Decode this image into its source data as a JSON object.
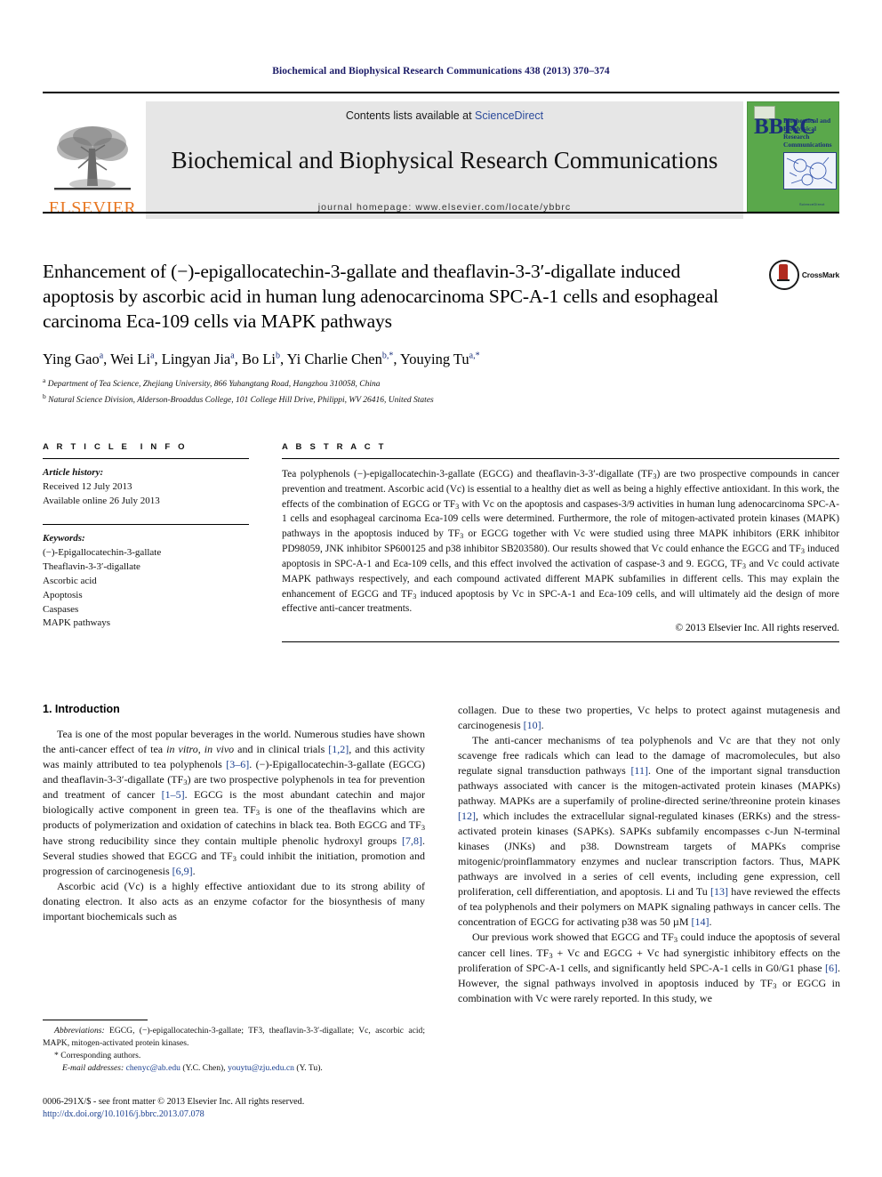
{
  "running_head": "Biochemical and Biophysical Research Communications 438 (2013) 370–374",
  "masthead": {
    "publisher": "ELSEVIER",
    "contents_prefix": "Contents lists available at ",
    "contents_link": "ScienceDirect",
    "journal_title": "Biochemical and Biophysical Research Communications",
    "homepage": "journal homepage: www.elsevier.com/locate/ybbrc",
    "cover": {
      "acronym": "BBRC",
      "title_lines": "Biochemical and Biophysical Research Communications",
      "footer": "ScienceDirect"
    }
  },
  "article": {
    "title": "Enhancement of (−)-epigallocatechin-3-gallate and theaflavin-3-3′-digallate induced apoptosis by ascorbic acid in human lung adenocarcinoma SPC-A-1 cells and esophageal carcinoma Eca-109 cells via MAPK pathways",
    "crossmark_label": "CrossMark",
    "authors": "Ying Gao a, Wei Li a, Lingyan Jia a, Bo Li b, Yi Charlie Chen b,*, Youying Tu a,*",
    "affiliations": [
      "a Department of Tea Science, Zhejiang University, 866 Yuhangtang Road, Hangzhou 310058, China",
      "b Natural Science Division, Alderson-Broaddus College, 101 College Hill Drive, Philippi, WV 26416, United States"
    ]
  },
  "article_info": {
    "heading": "ARTICLE INFO",
    "history_label": "Article history:",
    "history": [
      "Received 12 July 2013",
      "Available online 26 July 2013"
    ],
    "keywords_label": "Keywords:",
    "keywords": [
      "(−)-Epigallocatechin-3-gallate",
      "Theaflavin-3-3′-digallate",
      "Ascorbic acid",
      "Apoptosis",
      "Caspases",
      "MAPK pathways"
    ]
  },
  "abstract": {
    "heading": "ABSTRACT",
    "text": "Tea polyphenols (−)-epigallocatechin-3-gallate (EGCG) and theaflavin-3-3′-digallate (TF3) are two prospective compounds in cancer prevention and treatment. Ascorbic acid (Vc) is essential to a healthy diet as well as being a highly effective antioxidant. In this work, the effects of the combination of EGCG or TF3 with Vc on the apoptosis and caspases-3/9 activities in human lung adenocarcinoma SPC-A-1 cells and esophageal carcinoma Eca-109 cells were determined. Furthermore, the role of mitogen-activated protein kinases (MAPK) pathways in the apoptosis induced by TF3 or EGCG together with Vc were studied using three MAPK inhibitors (ERK inhibitor PD98059, JNK inhibitor SP600125 and p38 inhibitor SB203580). Our results showed that Vc could enhance the EGCG and TF3 induced apoptosis in SPC-A-1 and Eca-109 cells, and this effect involved the activation of caspase-3 and 9. EGCG, TF3 and Vc could activate MAPK pathways respectively, and each compound activated different MAPK subfamilies in different cells. This may explain the enhancement of EGCG and TF3 induced apoptosis by Vc in SPC-A-1 and Eca-109 cells, and will ultimately aid the design of more effective anti-cancer treatments.",
    "copyright": "© 2013 Elsevier Inc. All rights reserved."
  },
  "introduction": {
    "heading": "1. Introduction",
    "left_paragraphs": [
      "Tea is one of the most popular beverages in the world. Numerous studies have shown the anti-cancer effect of tea in vitro, in vivo and in clinical trials [1,2], and this activity was mainly attributed to tea polyphenols [3–6]. (−)-Epigallocatechin-3-gallate (EGCG) and theaflavin-3-3′-digallate (TF3) are two prospective polyphenols in tea for prevention and treatment of cancer [1–5]. EGCG is the most abundant catechin and major biologically active component in green tea. TF3 is one of the theaflavins which are products of polymerization and oxidation of catechins in black tea. Both EGCG and TF3 have strong reducibility since they contain multiple phenolic hydroxyl groups [7,8]. Several studies showed that EGCG and TF3 could inhibit the initiation, promotion and progression of carcinogenesis [6,9].",
      "Ascorbic acid (Vc) is a highly effective antioxidant due to its strong ability of donating electron. It also acts as an enzyme cofactor for the biosynthesis of many important biochemicals such as"
    ],
    "right_paragraphs": [
      "collagen. Due to these two properties, Vc helps to protect against mutagenesis and carcinogenesis [10].",
      "The anti-cancer mechanisms of tea polyphenols and Vc are that they not only scavenge free radicals which can lead to the damage of macromolecules, but also regulate signal transduction pathways [11]. One of the important signal transduction pathways associated with cancer is the mitogen-activated protein kinases (MAPKs) pathway. MAPKs are a superfamily of proline-directed serine/threonine protein kinases [12], which includes the extracellular signal-regulated kinases (ERKs) and the stress-activated protein kinases (SAPKs). SAPKs subfamily encompasses c-Jun N-terminal kinases (JNKs) and p38. Downstream targets of MAPKs comprise mitogenic/proinflammatory enzymes and nuclear transcription factors. Thus, MAPK pathways are involved in a series of cell events, including gene expression, cell proliferation, cell differentiation, and apoptosis. Li and Tu [13] have reviewed the effects of tea polyphenols and their polymers on MAPK signaling pathways in cancer cells. The concentration of EGCG for activating p38 was 50 µM [14].",
      "Our previous work showed that EGCG and TF3 could induce the apoptosis of several cancer cell lines. TF3 + Vc and EGCG + Vc had synergistic inhibitory effects on the proliferation of SPC-A-1 cells, and significantly held SPC-A-1 cells in G0/G1 phase [6]. However, the signal pathways involved in apoptosis induced by TF3 or EGCG in combination with Vc were rarely reported. In this study, we"
    ]
  },
  "footnotes": {
    "abbreviations_label": "Abbreviations:",
    "abbreviations_text": "EGCG, (−)-epigallocatechin-3-gallate; TF3, theaflavin-3-3′-digallate; Vc, ascorbic acid; MAPK, mitogen-activated protein kinases.",
    "corresponding": "* Corresponding authors.",
    "email_label": "E-mail addresses:",
    "email_1": "chenyc@ab.edu",
    "email_1_owner": "(Y.C. Chen),",
    "email_2": "youytu@zju.edu.cn",
    "email_2_owner": "(Y. Tu)."
  },
  "imprint": {
    "issn_line": "0006-291X/$ - see front matter © 2013 Elsevier Inc. All rights reserved.",
    "doi_line": "http://dx.doi.org/10.1016/j.bbrc.2013.07.078"
  }
}
